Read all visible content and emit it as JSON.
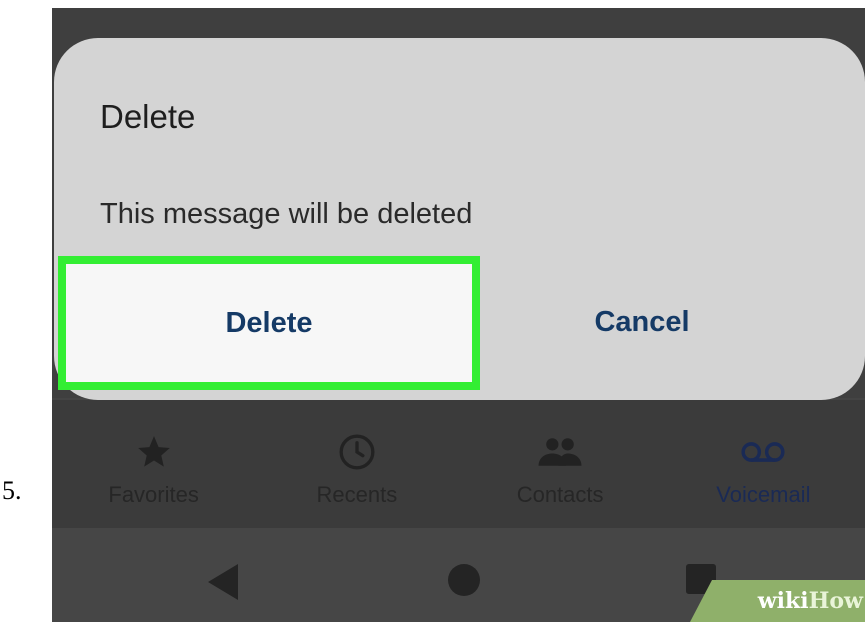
{
  "step": {
    "number": "5."
  },
  "dialog": {
    "title": "Delete",
    "message": "This message will be deleted",
    "confirm_label": "Delete",
    "cancel_label": "Cancel",
    "highlight_color": "#33ee33"
  },
  "bottom_nav": {
    "items": [
      {
        "label": "Favorites",
        "icon": "star-icon"
      },
      {
        "label": "Recents",
        "icon": "clock-icon"
      },
      {
        "label": "Contacts",
        "icon": "contacts-icon"
      },
      {
        "label": "Voicemail",
        "icon": "voicemail-icon",
        "active": true
      }
    ]
  },
  "system_nav": {
    "buttons": [
      "back-icon",
      "home-icon",
      "recents-icon"
    ]
  },
  "watermark": {
    "wiki": "wiki",
    "how": "How"
  }
}
